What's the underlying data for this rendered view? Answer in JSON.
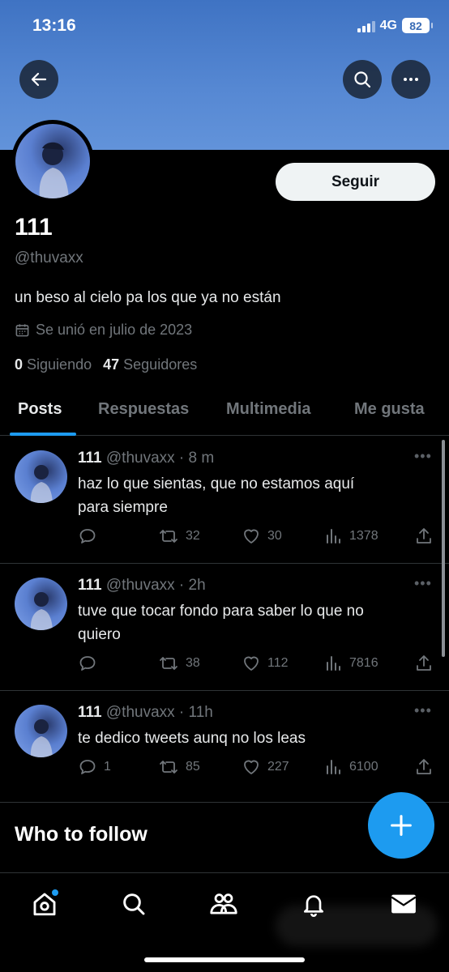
{
  "status_bar": {
    "time": "13:16",
    "network": "4G",
    "battery": "82"
  },
  "profile": {
    "display_name": "111",
    "handle": "@thuvaxx",
    "bio": "un beso al cielo pa los que ya no están",
    "joined": "Se unió en julio de 2023",
    "following_count": "0",
    "following_label": "Siguiendo",
    "followers_count": "47",
    "followers_label": "Seguidores",
    "follow_button": "Seguir"
  },
  "tabs": [
    "Posts",
    "Respuestas",
    "Multimedia",
    "Me gusta"
  ],
  "active_tab": "Posts",
  "tweets": [
    {
      "name": "111",
      "meta": "@thuvaxx · 8 m",
      "lines": [
        "haz lo que sientas, que no estamos aquí",
        "para siempre"
      ],
      "replies": "",
      "retweets": "32",
      "likes": "30",
      "views": "1378"
    },
    {
      "name": "111",
      "meta": "@thuvaxx · 2h",
      "lines": [
        "tuve que tocar fondo para saber lo que no",
        "quiero"
      ],
      "replies": "",
      "retweets": "38",
      "likes": "112",
      "views": "7816"
    },
    {
      "name": "111",
      "meta": "@thuvaxx · 11h",
      "lines": [
        "te dedico tweets aunq no los leas"
      ],
      "replies": "1",
      "retweets": "85",
      "likes": "227",
      "views": "6100"
    }
  ],
  "who_to_follow": "Who to follow",
  "icons": {
    "back": "arrow-left-icon",
    "search": "search-icon",
    "more": "more-horizontal-icon",
    "calendar": "calendar-icon",
    "reply": "reply-icon",
    "retweet": "retweet-icon",
    "like": "heart-icon",
    "views": "views-icon",
    "share": "share-icon",
    "compose": "plus-icon",
    "home": "home-icon",
    "explore": "search-icon",
    "communities": "communities-icon",
    "notifications": "bell-icon",
    "messages": "mail-icon"
  },
  "colors": {
    "accent": "#1d9bf0",
    "background": "#000000",
    "banner": "#5688d3",
    "muted_text": "#71767b"
  }
}
